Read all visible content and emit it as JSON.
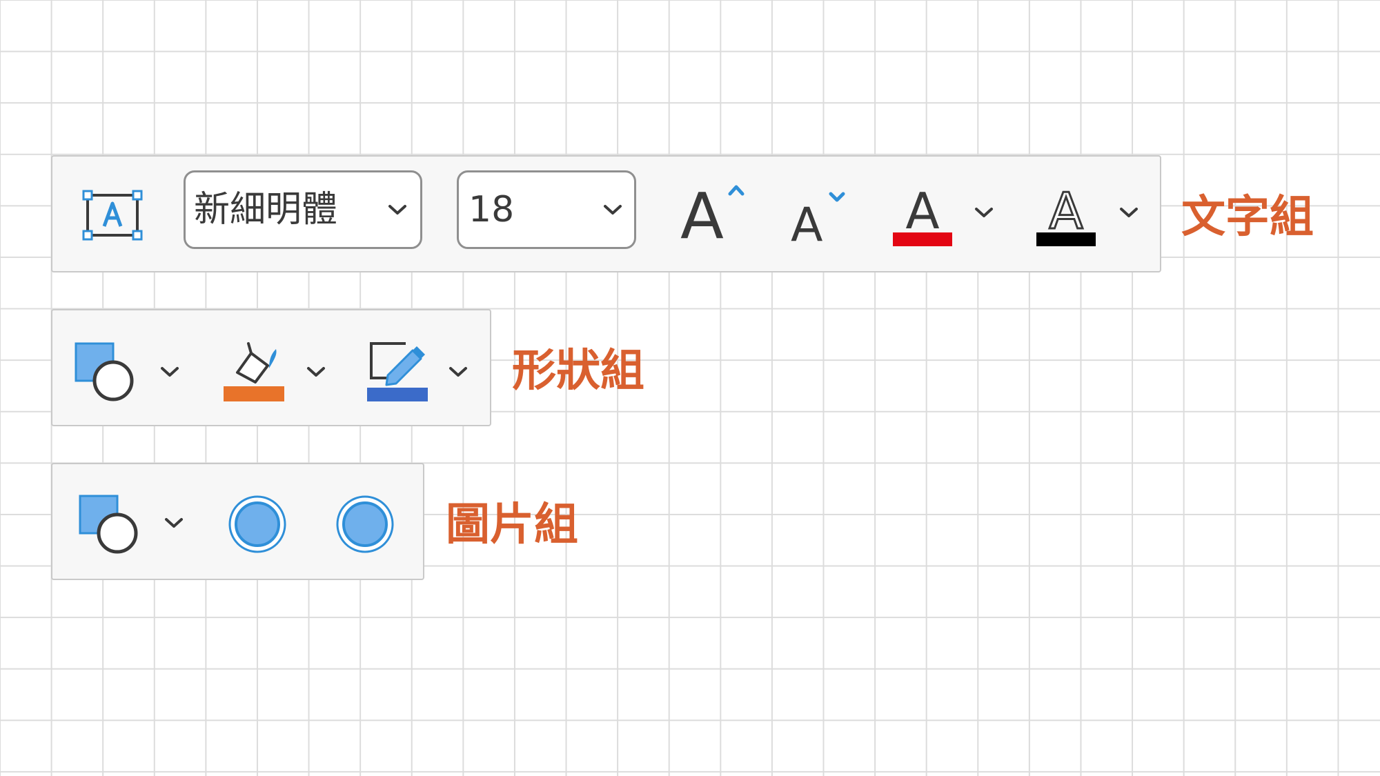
{
  "text_group": {
    "label": "文字組",
    "font_name": "新細明體",
    "font_size": "18",
    "grow_glyph": "A",
    "shrink_glyph": "A",
    "font_color_glyph": "A",
    "font_color_swatch": "#e30613",
    "outline_color_glyph": "A",
    "outline_color_swatch": "#000000"
  },
  "shape_group": {
    "label": "形狀組",
    "fill_swatch": "#e8732a",
    "outline_swatch": "#3b6bc9"
  },
  "picture_group": {
    "label": "圖片組"
  },
  "colors": {
    "label_accent": "#d9602f",
    "icon_blue": "#2f8fd8",
    "icon_light_blue": "#6fb0ec"
  },
  "icons": [
    "text-box-icon",
    "font-dropdown-chevron-icon",
    "size-dropdown-chevron-icon",
    "grow-font-icon",
    "shrink-font-icon",
    "font-color-icon",
    "text-outline-icon",
    "shape-style-icon",
    "fill-bucket-icon",
    "pen-outline-icon",
    "picture-style-icon",
    "circle-preset-icon"
  ]
}
